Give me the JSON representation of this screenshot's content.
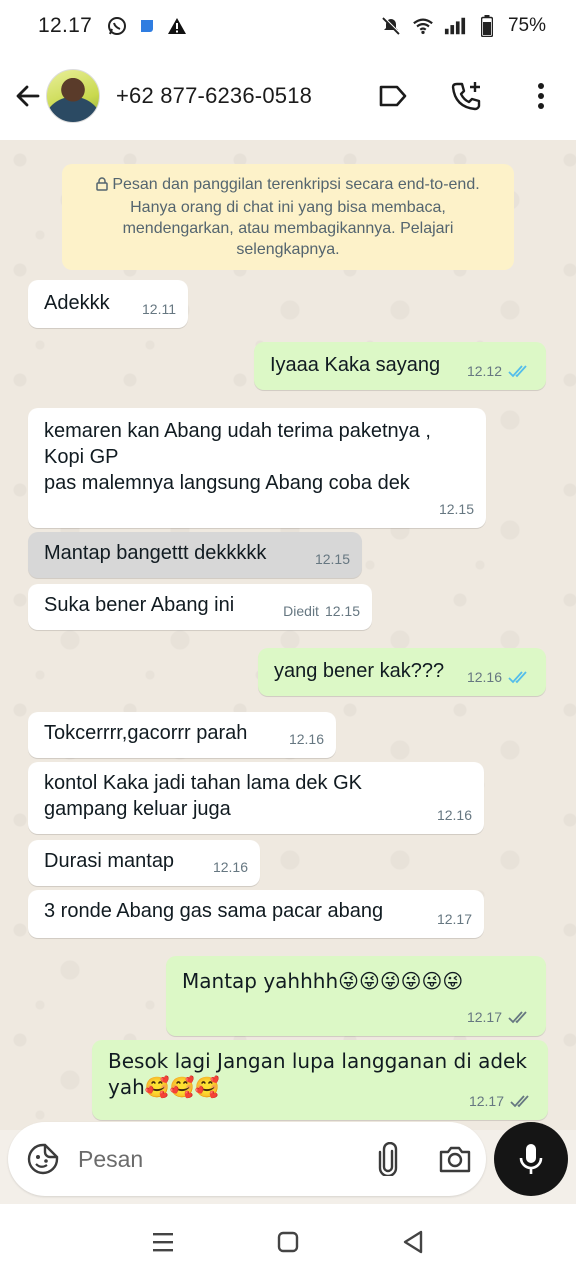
{
  "status_bar": {
    "time": "12.17",
    "battery": "75%",
    "left_icons": [
      "whatsapp-icon",
      "app-icon",
      "warning-icon"
    ],
    "right_icons": [
      "mute-icon",
      "wifi-icon",
      "signal-icon",
      "battery-icon"
    ]
  },
  "header": {
    "contact": "+62 877-6236-0518",
    "icons": [
      "back-arrow-icon",
      "label-icon",
      "add-call-icon",
      "more-vert-icon"
    ]
  },
  "encryption_notice": "Pesan dan panggilan terenkripsi secara end-to-end. Hanya orang di chat ini yang bisa membaca, mendengarkan, atau membagikannya. Pelajari selengkapnya.",
  "messages": [
    {
      "dir": "in",
      "text": "Adekkk",
      "time": "12.11"
    },
    {
      "dir": "out",
      "text": "Iyaaa Kaka sayang",
      "time": "12.12",
      "status": "read"
    },
    {
      "dir": "in",
      "text": "kemaren kan Abang udah terima paketnya ,\nKopi GP\npas malemnya langsung Abang coba dek",
      "time": "12.15"
    },
    {
      "dir": "in",
      "text": "Mantap bangettt dekkkkk",
      "time": "12.15",
      "selected": true
    },
    {
      "dir": "in",
      "text": "Suka bener Abang ini",
      "time": "12.15",
      "edited": "Diedit"
    },
    {
      "dir": "out",
      "text": "yang bener kak???",
      "time": "12.16",
      "status": "read"
    },
    {
      "dir": "in",
      "text": "Tokcerrrr,gacorrr parah",
      "time": "12.16"
    },
    {
      "dir": "in",
      "text": "kontol Kaka jadi tahan lama dek GK\ngampang keluar juga",
      "time": "12.16"
    },
    {
      "dir": "in",
      "text": "Durasi mantap",
      "time": "12.16"
    },
    {
      "dir": "in",
      "text": "3 ronde Abang gas sama pacar abang",
      "time": "12.17"
    },
    {
      "dir": "out",
      "text": "Mantap yahhhh😜😜😜😜😜😜",
      "time": "12.17",
      "status": "sent"
    },
    {
      "dir": "out",
      "text": "Besok lagi Jangan lupa langganan di adek\nyah🥰🥰🥰",
      "time": "12.17",
      "status": "sent"
    }
  ],
  "composer": {
    "placeholder": "Pesan",
    "icons": [
      "emoji-sticker-icon",
      "paperclip-icon",
      "camera-icon",
      "mic-icon"
    ]
  },
  "nav_bar": {
    "icons": [
      "recents-icon",
      "home-icon",
      "back-icon"
    ]
  },
  "colors": {
    "outgoing_bubble": "#dcf8c6",
    "incoming_bubble": "#ffffff",
    "read_tick": "#53bdeb",
    "encryption_bg": "#fdf2c9"
  }
}
